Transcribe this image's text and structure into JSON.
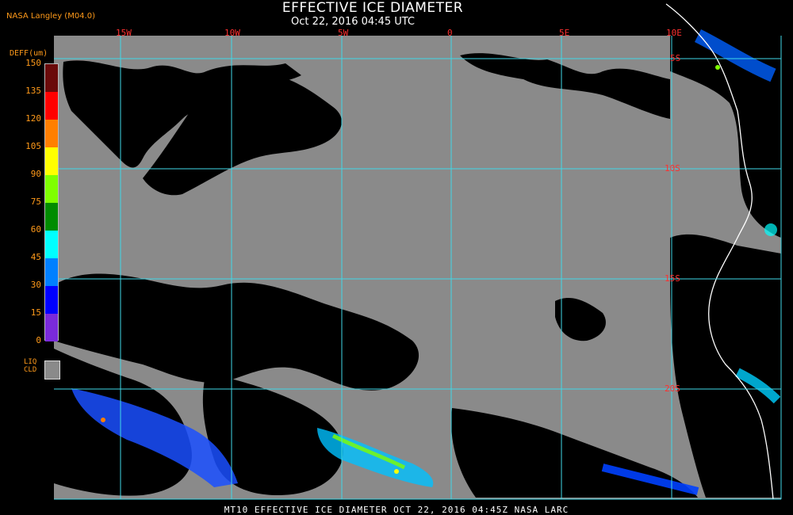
{
  "header": {
    "title": "EFFECTIVE ICE DIAMETER",
    "subtitle": "Oct 22, 2016 04:45 UTC",
    "source": "NASA Langley (M04.0)"
  },
  "map": {
    "longitude_labels": [
      "15W",
      "10W",
      "5W",
      "0",
      "5E",
      "10E"
    ],
    "latitude_labels": [
      "5S",
      "10S",
      "15S",
      "20S"
    ],
    "colors": {
      "liquid_cloud": "#8a8a8a",
      "clear": "#000000",
      "grid": "#40d8e8",
      "label": "#ff3030",
      "coastline": "#ffffff"
    }
  },
  "legend": {
    "unit_label": "DEFF(um)",
    "ticks": [
      "150",
      "135",
      "120",
      "105",
      "90",
      "75",
      "60",
      "45",
      "30",
      "15",
      "0"
    ],
    "colors": [
      "#6a0a0a",
      "#ff0000",
      "#ff7f00",
      "#ffff00",
      "#7fff00",
      "#008c00",
      "#00ffff",
      "#0080ff",
      "#0000ff",
      "#7a2adb"
    ],
    "liquid_label": "LIQ CLD",
    "liquid_color": "#8a8a8a"
  },
  "footer": {
    "caption": "MT10  EFFECTIVE ICE DIAMETER   OCT 22, 2016 04:45Z   NASA LARC"
  }
}
